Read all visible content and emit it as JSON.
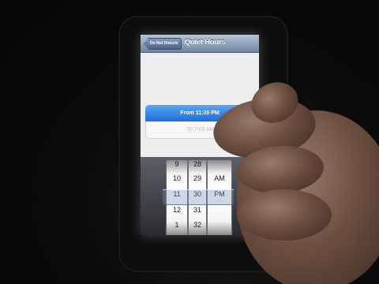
{
  "nav": {
    "back_label": "Do Not Disturb",
    "title": "Quiet Hours"
  },
  "rows": {
    "from_label": "From 11:30 PM",
    "to_label": "To 7:00 AM"
  },
  "picker": {
    "hours": [
      "9",
      "10",
      "11",
      "12",
      "1"
    ],
    "minutes": [
      "28",
      "29",
      "30",
      "31",
      "32"
    ],
    "ampm": [
      "AM",
      "PM"
    ],
    "selected": {
      "hour": "11",
      "minute": "30",
      "ampm": "PM"
    }
  },
  "colors": {
    "accent": "#1e6ed6",
    "navbar": "#6f85a3"
  }
}
